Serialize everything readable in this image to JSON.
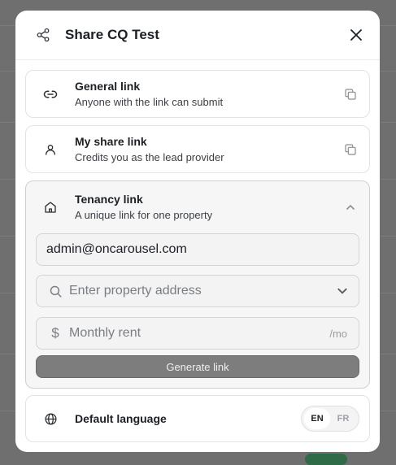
{
  "modal": {
    "title": "Share CQ Test"
  },
  "general_link": {
    "title": "General link",
    "subtitle": "Anyone with the link can submit"
  },
  "my_share_link": {
    "title": "My share link",
    "subtitle": "Credits you as the lead provider"
  },
  "tenancy_link": {
    "title": "Tenancy link",
    "subtitle": "A unique link for one property",
    "email_value": "admin@oncarousel.com",
    "address_placeholder": "Enter property address",
    "rent_placeholder": "Monthly rent",
    "rent_suffix": "/mo",
    "generate_label": "Generate link"
  },
  "language": {
    "label": "Default language",
    "options": [
      "EN",
      "FR"
    ],
    "selected": "EN"
  },
  "icons": {
    "header": "share-icon",
    "close": "close-icon",
    "general": "link-icon",
    "my_share": "user-icon",
    "tenancy": "home-icon",
    "copy": "copy-icon",
    "collapse": "chevron-up-icon",
    "search": "search-icon",
    "dropdown": "chevron-down-icon",
    "dollar": "dollar-icon",
    "language": "globe-icon"
  },
  "colors": {
    "overlay": "#6f6f6f",
    "surface": "#ffffff",
    "button_disabled": "#7d7d7d"
  }
}
